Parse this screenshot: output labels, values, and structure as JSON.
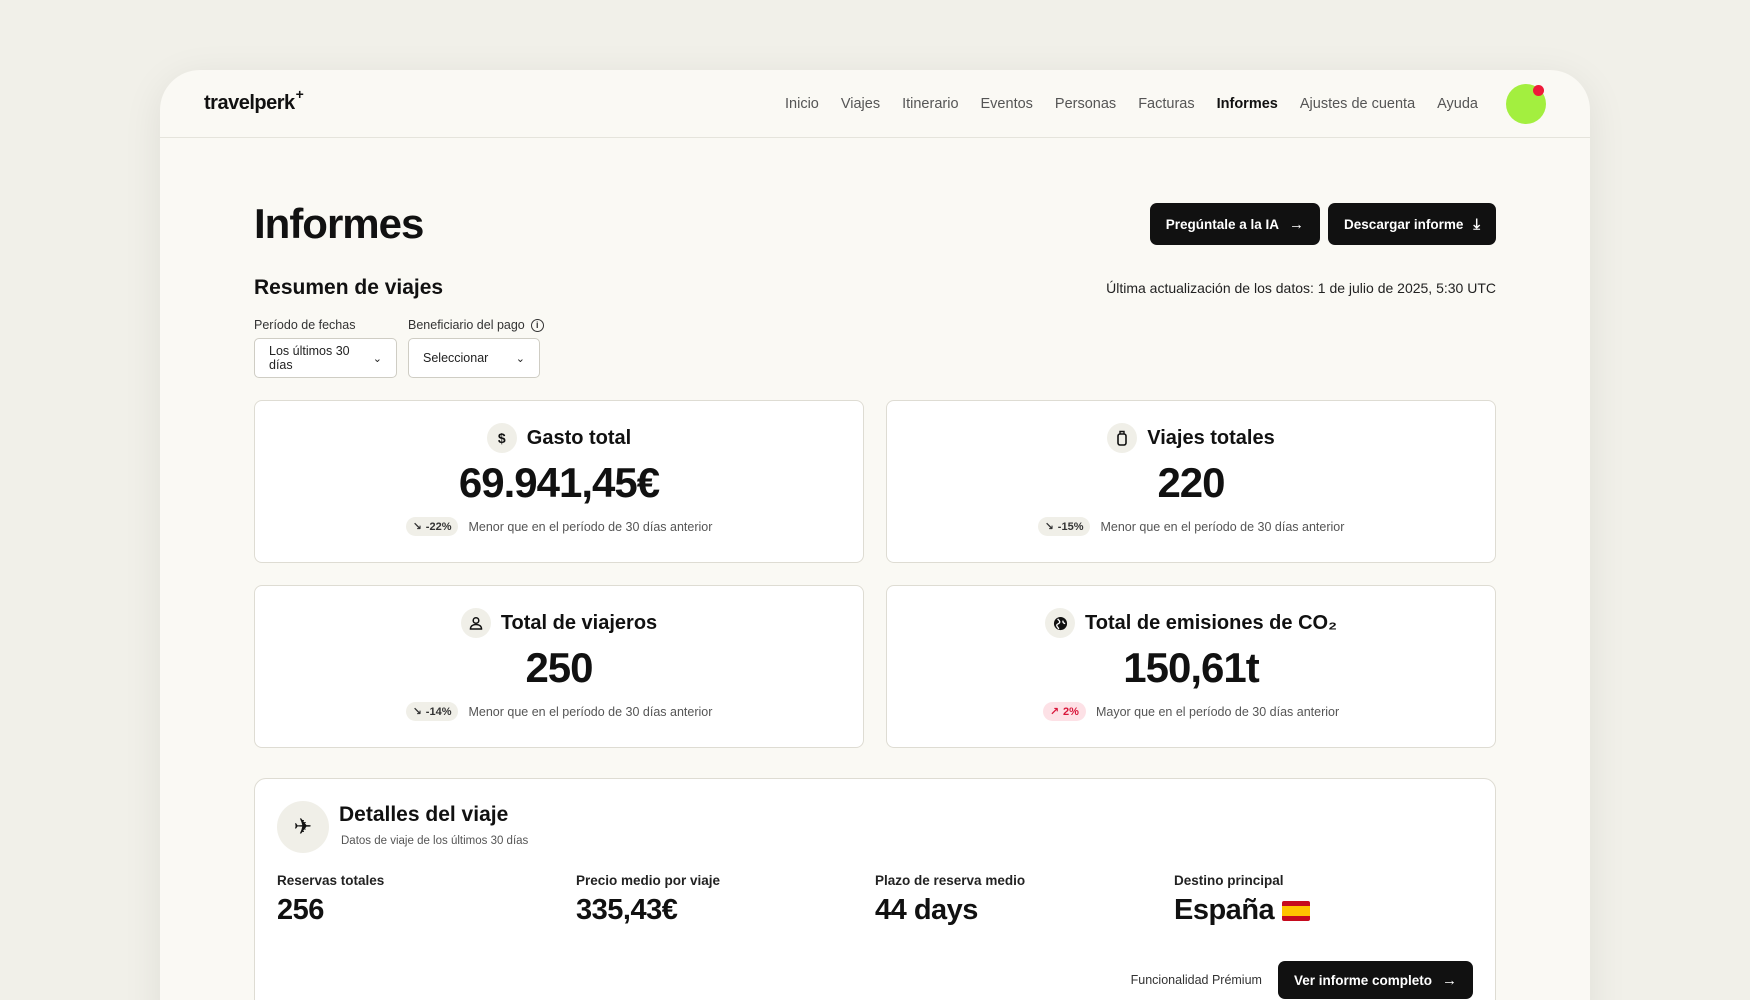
{
  "header": {
    "logo": "travelperk",
    "logo_sup": "+",
    "nav": [
      "Inicio",
      "Viajes",
      "Itinerario",
      "Eventos",
      "Personas",
      "Facturas",
      "Informes",
      "Ajustes de cuenta",
      "Ayuda"
    ],
    "active_nav": "Informes",
    "avatar_color": "#a3ef3f",
    "notification_color": "#ee1a3a"
  },
  "page": {
    "title": "Informes",
    "ask_ai_label": "Pregúntale a la IA",
    "download_label": "Descargar informe"
  },
  "summary": {
    "title": "Resumen de viajes",
    "updated": "Última actualización de los datos: 1 de julio de 2025, 5:30 UTC",
    "filters": {
      "period_label": "Período de fechas",
      "period_value": "Los últimos 30 días",
      "payer_label": "Beneficiario del pago",
      "payer_value": "Seleccionar"
    }
  },
  "cards": [
    {
      "icon": "dollar-icon",
      "title": "Gasto total",
      "value": "69.941,45€",
      "delta": "-22%",
      "direction": "down",
      "note": "Menor que en el período de 30 días anterior"
    },
    {
      "icon": "luggage-icon",
      "title": "Viajes totales",
      "value": "220",
      "delta": "-15%",
      "direction": "down",
      "note": "Menor que en el período de 30 días anterior"
    },
    {
      "icon": "person-icon",
      "title": "Total de viajeros",
      "value": "250",
      "delta": "-14%",
      "direction": "down",
      "note": "Menor que en el período de 30 días anterior"
    },
    {
      "icon": "globe-icon",
      "title": "Total de emisiones de CO₂",
      "value": "150,61t",
      "delta": "2%",
      "direction": "up",
      "note": "Mayor que en el período de 30 días anterior"
    }
  ],
  "details": {
    "title": "Detalles del viaje",
    "subtitle": "Datos de viaje de los últimos 30 días",
    "metrics": [
      {
        "label": "Reservas totales",
        "value": "256"
      },
      {
        "label": "Precio medio por viaje",
        "value": "335,43€"
      },
      {
        "label": "Plazo de reserva medio",
        "value": "44 days"
      },
      {
        "label": "Destino principal",
        "value": "España"
      }
    ],
    "premium_label": "Funcionalidad Prémium",
    "full_report_label": "Ver informe completo"
  }
}
